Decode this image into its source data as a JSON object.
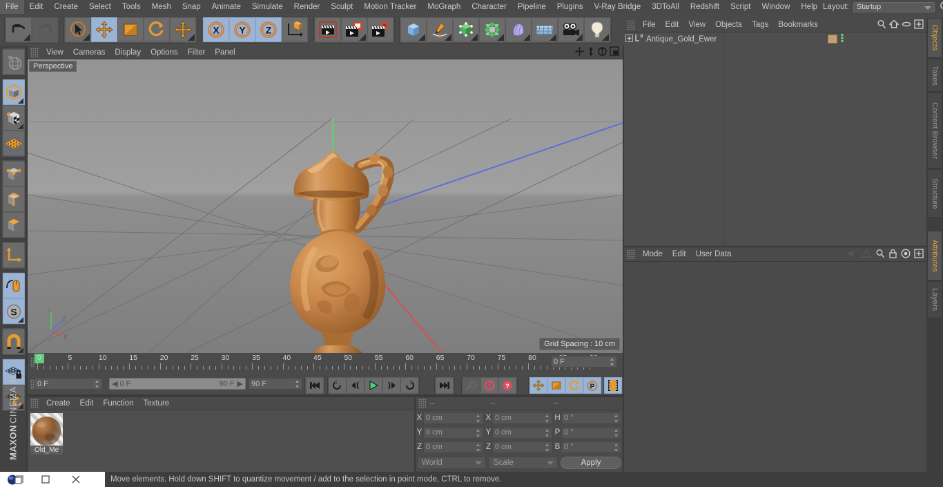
{
  "app": {
    "name": "CINEMA 4D",
    "brand": "MAXON"
  },
  "menubar": {
    "items": [
      "File",
      "Edit",
      "Create",
      "Select",
      "Tools",
      "Mesh",
      "Snap",
      "Animate",
      "Simulate",
      "Render",
      "Sculpt",
      "Motion Tracker",
      "MoGraph",
      "Character",
      "Pipeline",
      "Plugins",
      "V-Ray Bridge",
      "3DToAll",
      "Redshift",
      "Script",
      "Window",
      "Help"
    ],
    "layout_label": "Layout:",
    "layout_value": "Startup",
    "search_icon": "search-icon"
  },
  "toolbar": {
    "groups": [
      {
        "name": "undo-redo",
        "buttons": [
          {
            "name": "undo-button",
            "icon": "undo-icon",
            "state": "normal"
          },
          {
            "name": "redo-button",
            "icon": "redo-icon",
            "state": "disabled"
          }
        ]
      },
      {
        "name": "transform-tools",
        "buttons": [
          {
            "name": "live-selection-tool",
            "icon": "cursor-circle-icon",
            "state": "normal"
          },
          {
            "name": "move-tool",
            "icon": "move-arrows-icon",
            "state": "active"
          },
          {
            "name": "scale-tool",
            "icon": "scale-box-icon",
            "state": "normal"
          },
          {
            "name": "rotate-tool",
            "icon": "rotate-arc-icon",
            "state": "normal"
          },
          {
            "name": "pivot-tool",
            "icon": "move-arrows-icon",
            "state": "normal"
          }
        ]
      },
      {
        "name": "axis-locks",
        "buttons": [
          {
            "name": "lock-x-axis",
            "icon": "x-axis-icon",
            "state": "active"
          },
          {
            "name": "lock-y-axis",
            "icon": "y-axis-icon",
            "state": "active"
          },
          {
            "name": "lock-z-axis",
            "icon": "z-axis-icon",
            "state": "active"
          },
          {
            "name": "world-object-axis",
            "icon": "world-coord-icon",
            "state": "normal"
          }
        ]
      },
      {
        "name": "render-tools",
        "buttons": [
          {
            "name": "render-view-button",
            "icon": "clapper-view-icon",
            "state": "normal"
          },
          {
            "name": "render-to-picture-viewer-button",
            "icon": "clapper-picture-icon",
            "state": "normal"
          },
          {
            "name": "render-settings-button",
            "icon": "clapper-gear-icon",
            "state": "normal"
          }
        ]
      },
      {
        "name": "create-objects",
        "buttons": [
          {
            "name": "add-cube-button",
            "icon": "cube-blue-icon",
            "state": "normal"
          },
          {
            "name": "add-spline-button",
            "icon": "pen-spline-icon",
            "state": "normal"
          },
          {
            "name": "add-generator-button",
            "icon": "green-cube-icon",
            "state": "normal"
          },
          {
            "name": "add-modeling-object-button",
            "icon": "green-cluster-icon",
            "state": "normal"
          },
          {
            "name": "add-deformer-button",
            "icon": "bend-deformer-icon",
            "state": "normal"
          },
          {
            "name": "add-scene-object-button",
            "icon": "floor-grid-icon",
            "state": "normal"
          },
          {
            "name": "add-camera-button",
            "icon": "camera-icon",
            "state": "normal"
          },
          {
            "name": "add-light-button",
            "icon": "lightbulb-icon",
            "state": "normal"
          }
        ]
      }
    ]
  },
  "left_palette": {
    "groups": [
      {
        "name": "group-undo-view",
        "buttons": [
          {
            "name": "make-editable-button",
            "icon": "globe-sphere-icon",
            "state": "normal"
          }
        ]
      },
      {
        "name": "group-modes",
        "buttons": [
          {
            "name": "model-mode-button",
            "icon": "model-cube-icon",
            "state": "active"
          },
          {
            "name": "texture-mode-button",
            "icon": "checker-cube-icon",
            "state": "normal"
          },
          {
            "name": "workplane-mode-button",
            "icon": "orange-grid-icon",
            "state": "normal"
          }
        ]
      },
      {
        "name": "group-components",
        "buttons": [
          {
            "name": "points-mode-button",
            "icon": "points-cube-icon",
            "state": "normal"
          },
          {
            "name": "edges-mode-button",
            "icon": "edges-cube-icon",
            "state": "normal"
          },
          {
            "name": "polygons-mode-button",
            "icon": "polygon-cube-icon",
            "state": "normal"
          }
        ]
      },
      {
        "name": "group-axis",
        "buttons": [
          {
            "name": "enable-axis-modification-button",
            "icon": "axis-l-icon",
            "state": "normal"
          }
        ]
      },
      {
        "name": "group-snap-soft",
        "buttons": [
          {
            "name": "viewport-solo-button",
            "icon": "mouse-soft-icon",
            "state": "active"
          },
          {
            "name": "soft-selection-button",
            "icon": "s-compass-icon",
            "state": "active"
          }
        ]
      },
      {
        "name": "group-magnet",
        "buttons": [
          {
            "name": "snap-magnet-button",
            "icon": "magnet-icon",
            "state": "normal"
          }
        ]
      },
      {
        "name": "group-workplane",
        "buttons": [
          {
            "name": "lock-workplane-button",
            "icon": "grid-lock-icon",
            "state": "active"
          },
          {
            "name": "planar-workplane-button",
            "icon": "grid-rotate-icon",
            "state": "normal"
          }
        ]
      }
    ]
  },
  "viewport": {
    "menu": [
      "View",
      "Cameras",
      "Display",
      "Options",
      "Filter",
      "Panel"
    ],
    "view_label": "Perspective",
    "grid_spacing": "Grid Spacing : 10 cm",
    "axis_labels": {
      "x": "X",
      "y": "Y",
      "z": "Z"
    },
    "corner_icons": [
      {
        "name": "viewport-pan-icon"
      },
      {
        "name": "viewport-dolly-icon"
      },
      {
        "name": "viewport-rotate-icon"
      },
      {
        "name": "viewport-maximize-icon"
      }
    ],
    "model": {
      "name": "Antique_Gold_Ewer",
      "color": "#c17f3e"
    }
  },
  "timeline": {
    "start_tick": 0,
    "end_tick": 90,
    "tick_step": 5,
    "labels": [
      "0",
      "5",
      "10",
      "15",
      "20",
      "25",
      "30",
      "35",
      "40",
      "45",
      "50",
      "55",
      "60",
      "65",
      "70",
      "75",
      "80",
      "85",
      "90"
    ],
    "current_frame_field": "0 F",
    "preview_min": "0 F",
    "preview_max": "90 F",
    "doc_end_field": "90 F",
    "right_frame_field": "0 F",
    "transport": [
      {
        "name": "go-to-start-button",
        "icon": "skip-start-icon"
      },
      {
        "name": "play-reverse-button",
        "icon": "rewind-loop-icon"
      },
      {
        "name": "step-back-button",
        "icon": "prev-frame-icon"
      },
      {
        "name": "play-button",
        "icon": "play-icon"
      },
      {
        "name": "step-forward-button",
        "icon": "next-frame-icon"
      },
      {
        "name": "play-forward-loop-button",
        "icon": "forward-loop-icon"
      },
      {
        "name": "go-to-end-button",
        "icon": "skip-end-icon"
      }
    ],
    "keyframe_tools": [
      {
        "name": "record-active-objects-button",
        "icon": "key-icon",
        "state": "disabled"
      },
      {
        "name": "autokeying-button",
        "icon": "autokey-icon",
        "state": "normal"
      },
      {
        "name": "keyframe-selection-button",
        "icon": "question-key-icon",
        "state": "normal"
      }
    ],
    "param_toggles": [
      {
        "name": "position-key-toggle",
        "icon": "move-arrows-icon",
        "state": "active"
      },
      {
        "name": "scale-key-toggle",
        "icon": "scale-box-icon",
        "state": "active"
      },
      {
        "name": "rotation-key-toggle",
        "icon": "rotate-arc-icon",
        "state": "active"
      },
      {
        "name": "parameter-key-toggle",
        "icon": "p-circle-icon",
        "state": "active"
      },
      {
        "name": "point-level-animation-toggle",
        "icon": "dots-grid-icon",
        "state": "normal"
      }
    ],
    "filmstrip_button": {
      "name": "animation-filmstrip-button",
      "icon": "filmstrip-icon",
      "state": "active"
    }
  },
  "material_manager": {
    "menu": [
      "Create",
      "Edit",
      "Function",
      "Texture"
    ],
    "materials": [
      {
        "name": "Old_Me",
        "color": "#8a5b35"
      }
    ]
  },
  "coordinates": {
    "header": [
      "--",
      "--",
      "--"
    ],
    "rows": [
      {
        "pos_label": "X",
        "pos_value": "0 cm",
        "size_label": "X",
        "size_value": "0 cm",
        "rot_label": "H",
        "rot_value": "0 °"
      },
      {
        "pos_label": "Y",
        "pos_value": "0 cm",
        "size_label": "Y",
        "size_value": "0 cm",
        "rot_label": "P",
        "rot_value": "0 °"
      },
      {
        "pos_label": "Z",
        "pos_value": "0 cm",
        "size_label": "Z",
        "size_value": "0 cm",
        "rot_label": "B",
        "rot_value": "0 °"
      }
    ],
    "system_select": "World",
    "mode_select": "Scale",
    "apply_label": "Apply"
  },
  "object_manager": {
    "menu": [
      "File",
      "Edit",
      "View",
      "Objects",
      "Tags",
      "Bookmarks"
    ],
    "icons": [
      {
        "name": "object-search-icon"
      },
      {
        "name": "object-home-icon"
      },
      {
        "name": "object-visibility-icon"
      },
      {
        "name": "object-fullscreen-icon"
      }
    ],
    "objects": [
      {
        "name": "Antique_Gold_Ewer",
        "expandable": true,
        "layer_badge": "0",
        "tag_color": "#c4a070"
      }
    ]
  },
  "attributes": {
    "menu": [
      "Mode",
      "Edit",
      "User Data"
    ],
    "icons": [
      {
        "name": "attributes-history-back-icon"
      },
      {
        "name": "attributes-history-forward-icon"
      },
      {
        "name": "attributes-search-icon"
      },
      {
        "name": "attributes-lock-icon"
      },
      {
        "name": "attributes-target-icon"
      },
      {
        "name": "attributes-fullscreen-icon"
      }
    ]
  },
  "right_tabs": {
    "upper": [
      {
        "label": "Objects",
        "selected": true
      },
      {
        "label": "Takes",
        "selected": false
      },
      {
        "label": "Content Browser",
        "selected": false
      },
      {
        "label": "Structure",
        "selected": false
      }
    ],
    "lower": [
      {
        "label": "Attributes",
        "selected": true
      },
      {
        "label": "Layers",
        "selected": false
      }
    ]
  },
  "statusbar": {
    "text": "Move elements. Hold down SHIFT to quantize movement / add to the selection in point mode, CTRL to remove."
  },
  "taskbar": {
    "items": [
      {
        "name": "taskbar-app-icon",
        "icon": "c4d-logo-icon"
      },
      {
        "name": "taskbar-restore-button",
        "icon": "restore-icon"
      },
      {
        "name": "taskbar-maximize-button",
        "icon": "maximize-icon"
      },
      {
        "name": "taskbar-close-button",
        "icon": "close-icon"
      }
    ]
  },
  "colors": {
    "accent_orange": "#e0a243",
    "active_blue": "#9bb4d4",
    "panel_bg": "#4a4a4a",
    "viewport_bg": "#8e8e8e"
  }
}
